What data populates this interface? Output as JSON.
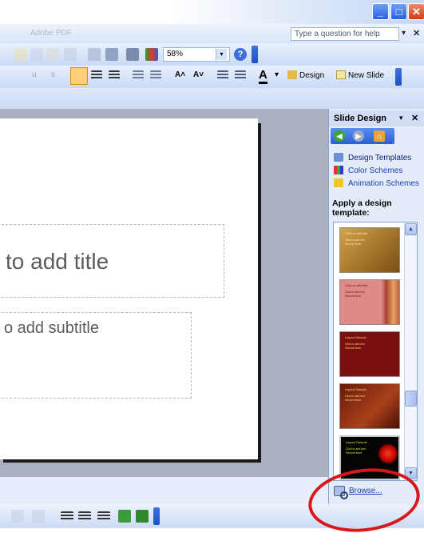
{
  "window": {
    "min_glyph": "_",
    "max_glyph": "□",
    "close_glyph": "✕"
  },
  "menubar": {
    "adobe_pdf_label": "Adobe PDF",
    "help_placeholder": "Type a question for help",
    "help_dropdown_glyph": "▾",
    "close_glyph": "✕"
  },
  "toolbar_standard": {
    "zoom_value": "58%",
    "zoom_dropdown_glyph": "▾",
    "help_glyph": "?"
  },
  "toolbar_formatting": {
    "underline_glyph": "u",
    "shadow_glyph": "s",
    "grow_font_glyph": "A˄",
    "shrink_font_glyph": "A˅",
    "font_color_glyph": "A",
    "font_color_dropdown_glyph": "▾",
    "design_label": "Design",
    "new_slide_label": "New Slide"
  },
  "slide": {
    "title_placeholder": "to add title",
    "subtitle_placeholder": "o add subtitle"
  },
  "task_pane": {
    "title": "Slide Design",
    "dropdown_glyph": "▾",
    "close_glyph": "✕",
    "nav_back_glyph": "◀",
    "nav_forward_glyph": "▶",
    "nav_home_glyph": "⌂",
    "links": [
      "Design Templates",
      "Color Schemes",
      "Animation Schemes"
    ],
    "apply_heading": "Apply a design template:",
    "browse_label": "Browse...",
    "scroll_up_glyph": "▲",
    "scroll_down_glyph": "▼",
    "templates": [
      {
        "line1": "Click to add title",
        "line2": "Click to add text",
        "line3": "Second level"
      },
      {
        "line1": "Click to add title",
        "line2": "Click to add text",
        "line3": "Second level"
      },
      {
        "line1": "Layout Sample",
        "line2": "Click to add text",
        "line3": "Second level"
      },
      {
        "line1": "Layout Sample",
        "line2": "Click to add text",
        "line3": "Second level"
      },
      {
        "line1": "Layout Sample",
        "line2": "Click to add text",
        "line3": "Second level"
      }
    ]
  },
  "colors": {
    "xp_blue": "#2a5fdc",
    "close_red": "#d23b14",
    "highlight_ring": "#d81818",
    "link_blue": "#1a3fb3"
  }
}
